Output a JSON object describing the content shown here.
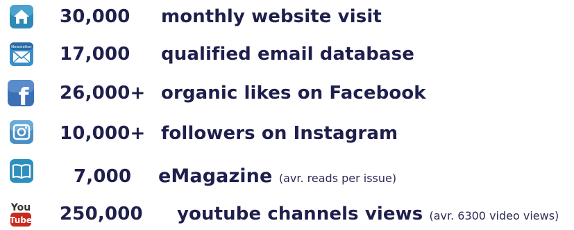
{
  "colors": {
    "text": "#1f1f4d",
    "home_icon": "#2f89b6",
    "newsletter_icon": "#3a8fc7",
    "facebook_icon": "#3b6fb6",
    "instagram_icon": "#4a8fc4",
    "magazine_icon": "#2c8fbd",
    "youtube_icon": "#c92a1e"
  },
  "stats": [
    {
      "icon": "home-icon",
      "number": "30,000",
      "label": "monthly website visit",
      "note": ""
    },
    {
      "icon": "newsletter-icon",
      "icon_text": "Newsletter",
      "number": "17,000",
      "label": "qualified email database",
      "note": ""
    },
    {
      "icon": "facebook-icon",
      "icon_text": "f",
      "number": "26,000+",
      "label": "organic likes on Facebook",
      "note": ""
    },
    {
      "icon": "instagram-icon",
      "number": "10,000+",
      "label": "followers on Instagram",
      "note": ""
    },
    {
      "icon": "book-icon",
      "number": "7,000",
      "label": "eMagazine",
      "note": "(avr. reads per issue)"
    },
    {
      "icon": "youtube-icon",
      "icon_text_top": "You",
      "icon_text_bottom": "Tube",
      "number": "250,000",
      "label": "youtube channels views",
      "note": "(avr. 6300 video views)"
    }
  ]
}
